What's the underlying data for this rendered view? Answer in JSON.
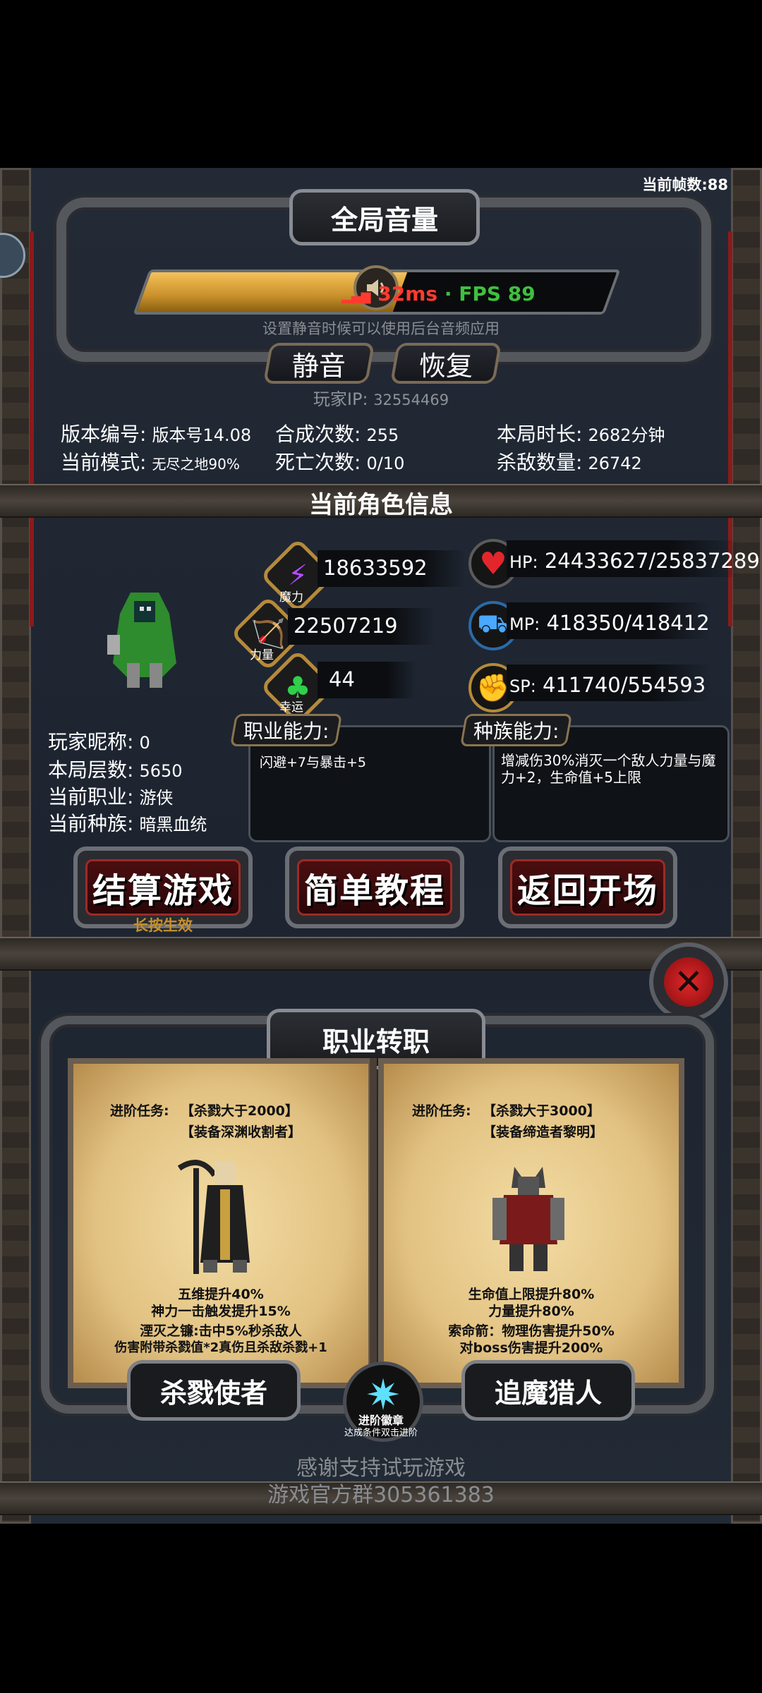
{
  "fps_counter": "当前帧数:88",
  "volume": {
    "title": "全局音量",
    "level": 0.55,
    "latency": "32ms",
    "fps": "· FPS 89",
    "hint": "设置静音时候可以使用后台音频应用",
    "mute_label": "静音",
    "restore_label": "恢复"
  },
  "player_ip": {
    "label": "玩家IP:",
    "value": "32554469"
  },
  "stats": {
    "version": {
      "label": "版本编号:",
      "value": "版本号14.08"
    },
    "mode": {
      "label": "当前模式:",
      "value": "无尽之地90%"
    },
    "craft": {
      "label": "合成次数:",
      "value": "255"
    },
    "deaths": {
      "label": "死亡次数:",
      "value": "0/10"
    },
    "duration": {
      "label": "本局时长:",
      "value": "2682分钟"
    },
    "kills": {
      "label": "杀敌数量:",
      "value": "26742"
    }
  },
  "character": {
    "section_title": "当前角色信息",
    "magic": {
      "label": "魔力",
      "value": "18633592"
    },
    "strength": {
      "label": "力量",
      "value": "22507219"
    },
    "luck": {
      "label": "幸运",
      "value": "44"
    },
    "hp": {
      "label": "HP:",
      "value": "24433627/25837289"
    },
    "mp": {
      "label": "MP:",
      "value": "418350/418412"
    },
    "sp": {
      "label": "SP:",
      "value": "411740/554593"
    },
    "nickname": {
      "label": "玩家昵称:",
      "value": "0"
    },
    "floor": {
      "label": "本局层数:",
      "value": "5650"
    },
    "class": {
      "label": "当前职业:",
      "value": "游侠"
    },
    "race": {
      "label": "当前种族:",
      "value": "暗黑血统"
    },
    "class_ability": {
      "label": "职业能力:",
      "text": "闪避+7与暴击+5"
    },
    "race_ability": {
      "label": "种族能力:",
      "text": "增减伤30%消灭一个敌人力量与魔力+2，生命值+5上限"
    }
  },
  "actions": {
    "settle": "结算游戏",
    "settle_hint": "长按生效",
    "tutorial": "简单教程",
    "back": "返回开场"
  },
  "class_change": {
    "title": "职业转职",
    "left": {
      "task_label": "进阶任务:",
      "task1": "【杀戮大于2000】",
      "task2": "【装备深渊收割者】",
      "desc1": "五维提升40%",
      "desc2": "神力一击触发提升15%",
      "desc3": "湮灭之镰:击中5%秒杀敌人",
      "desc4": "伤害附带杀戮值*2真伤且杀敌杀戮+1",
      "name": "杀戮使者"
    },
    "right": {
      "task_label": "进阶任务:",
      "task1": "【杀戮大于3000】",
      "task2": "【装备缔造者黎明】",
      "desc1": "生命值上限提升80%",
      "desc2": "力量提升80%",
      "desc3": "索命箭：物理伤害提升50%",
      "desc4": "对boss伤害提升200%",
      "name": "追魔猎人"
    },
    "badge_title": "进阶徽章",
    "badge_hint": "达成条件双击进阶"
  },
  "footer": {
    "thanks": "感谢支持试玩游戏",
    "group": "游戏官方群305361383"
  },
  "colors": {
    "gold": "#c8902a",
    "fps_green": "#3fbf3f",
    "latency_red": "#ff3b2f"
  }
}
